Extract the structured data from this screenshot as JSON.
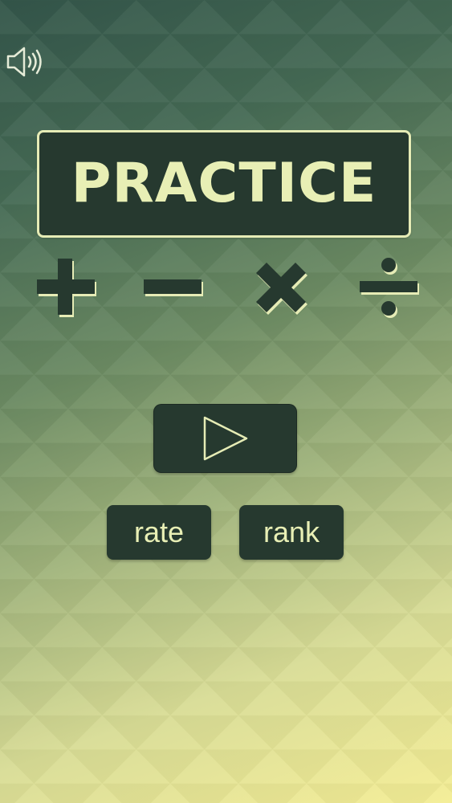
{
  "screen": {
    "title": "PRACTICE"
  },
  "icons": {
    "sound": "speaker-volume-icon",
    "play": "play-triangle-icon",
    "operations": [
      "plus-icon",
      "minus-icon",
      "multiply-icon",
      "divide-icon"
    ]
  },
  "buttons": {
    "rate_label": "rate",
    "rank_label": "rank"
  },
  "colors": {
    "panel": "#26392f",
    "text": "#e8efb5",
    "accent_border": "#e6ecb6"
  }
}
